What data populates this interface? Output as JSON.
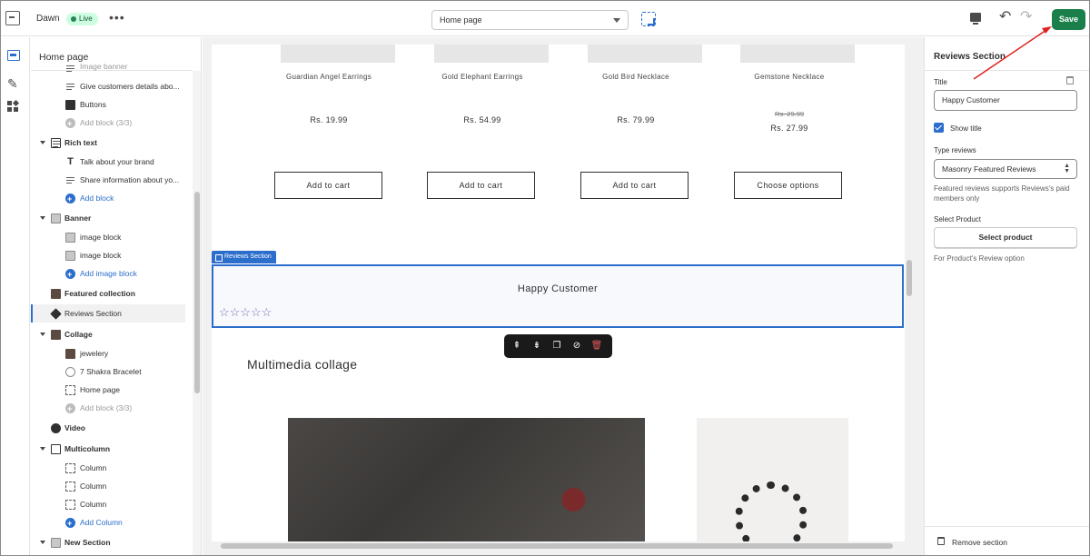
{
  "topbar": {
    "store_name": "Dawn",
    "status_badge": "Live",
    "more_label": "•••",
    "page_selector": "Home page",
    "undo_glyph": "↶",
    "redo_glyph": "↷",
    "save_label": "Save",
    "save_color": "#1a7f4b"
  },
  "sidebar": {
    "title": "Home page",
    "rows": [
      {
        "label": "Image banner",
        "icon": "image-icon"
      },
      {
        "label": "Give customers details abo...",
        "icon": "text-lines-icon"
      },
      {
        "label": "Buttons",
        "icon": "button-icon"
      },
      {
        "label": "Add block (3/3)",
        "icon": "add-icon"
      },
      {
        "label": "Rich text",
        "icon": "rich-text-icon"
      },
      {
        "label": "Talk about your brand",
        "icon": "heading-icon"
      },
      {
        "label": "Share information about yo...",
        "icon": "text-lines-icon"
      },
      {
        "label": "Add block",
        "icon": "add-icon"
      },
      {
        "label": "Banner",
        "icon": "image-icon"
      },
      {
        "label": "image block",
        "icon": "image-icon"
      },
      {
        "label": "image block",
        "icon": "image-icon"
      },
      {
        "label": "Add image block",
        "icon": "add-icon"
      },
      {
        "label": "Featured collection",
        "icon": "collection-icon"
      },
      {
        "label": "Reviews Section",
        "icon": "tag-icon"
      },
      {
        "label": "Collage",
        "icon": "collage-icon"
      },
      {
        "label": "jewelery",
        "icon": "collection-icon"
      },
      {
        "label": "7 Shakra Bracelet",
        "icon": "product-icon"
      },
      {
        "label": "Home page",
        "icon": "page-icon"
      },
      {
        "label": "Add block (3/3)",
        "icon": "add-icon"
      },
      {
        "label": "Video",
        "icon": "play-icon"
      },
      {
        "label": "Multicolumn",
        "icon": "columns-icon"
      },
      {
        "label": "Column",
        "icon": "column-icon"
      },
      {
        "label": "Column",
        "icon": "column-icon"
      },
      {
        "label": "Column",
        "icon": "column-icon"
      },
      {
        "label": "Add Column",
        "icon": "add-icon"
      },
      {
        "label": "New Section",
        "icon": "section-icon"
      }
    ]
  },
  "preview": {
    "products": [
      {
        "name": "Guardian Angel Earrings",
        "price": "Rs. 19.99",
        "button": "Add to cart"
      },
      {
        "name": "Gold Elephant Earrings",
        "price": "Rs. 54.99",
        "button": "Add to cart"
      },
      {
        "name": "Gold Bird Necklace",
        "price": "Rs. 79.99",
        "button": "Add to cart"
      },
      {
        "name": "Gemstone Necklace",
        "compare_price": "Rs. 29.99",
        "price": "Rs. 27.99",
        "button": "Choose options"
      }
    ],
    "reviews_tab": "Reviews Section",
    "reviews_title": "Happy Customer",
    "stars": "☆☆☆☆☆",
    "collage_title": "Multimedia collage"
  },
  "settings": {
    "title": "Reviews Section",
    "title_label": "Title",
    "title_value": "Happy Customer",
    "show_title_label": "Show title",
    "show_title_checked": true,
    "type_label": "Type reviews",
    "type_value": "Masonry Featured Reviews",
    "type_help": "Featured reviews supports Reviews's paid members only",
    "product_label": "Select Product",
    "product_button": "Select product",
    "product_help": "For Product's Review option",
    "remove_label": "Remove section"
  },
  "colors": {
    "accent": "#2c6ecb",
    "save_green": "#1a7f4b",
    "annotation_arrow": "#e02020"
  }
}
